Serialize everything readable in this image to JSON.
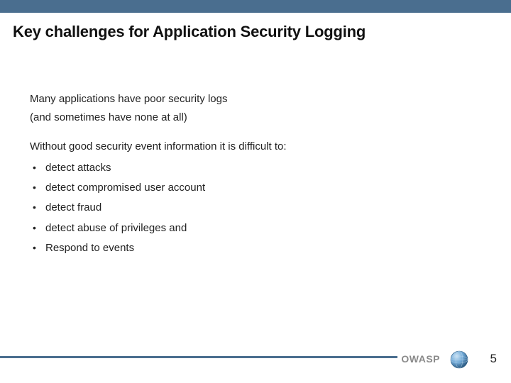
{
  "title": "Key challenges for Application Security Logging",
  "paragraph1": "Many applications have poor security logs",
  "paragraph2": "(and sometimes have none at all)",
  "lead": "Without good security event information it is difficult to:",
  "bullets": [
    "detect attacks",
    "detect compromised user account",
    "detect fraud",
    "detect abuse of privileges and",
    "Respond to events"
  ],
  "brand": "OWASP",
  "page_number": "5"
}
